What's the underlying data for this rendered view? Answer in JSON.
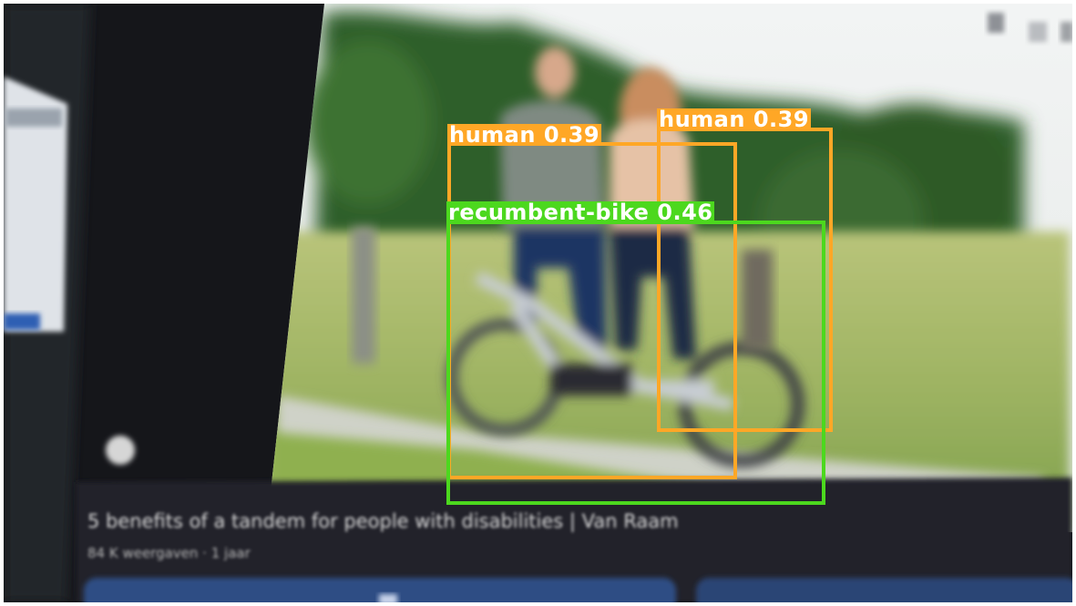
{
  "video_title": "5 benefits of a tandem for people with disabilities | Van Raam",
  "video_meta": "84 K weergaven · 1 jaar",
  "detections": [
    {
      "label": "human",
      "score": "0.39",
      "caption": "human 0.39",
      "color": "#ffa726"
    },
    {
      "label": "human",
      "score": "0.39",
      "caption": "human 0.39",
      "color": "#ffa726"
    },
    {
      "label": "recumbent-bike",
      "score": "0.46",
      "caption": "recumbent-bike 0.46",
      "color": "#4cd81e"
    }
  ]
}
